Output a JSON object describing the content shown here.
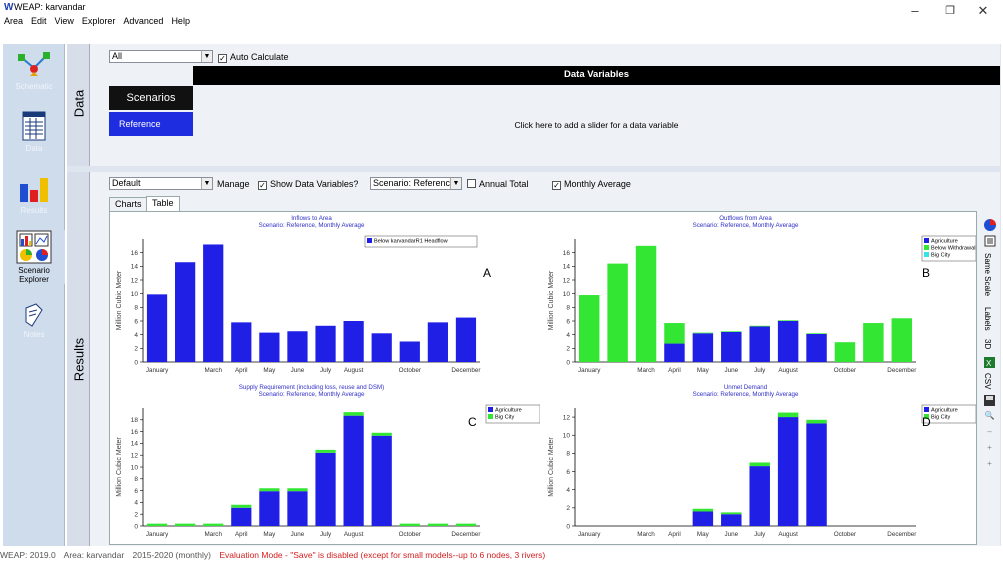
{
  "window": {
    "title": "WEAP: karvandar",
    "logo": "W"
  },
  "menu": [
    "Area",
    "Edit",
    "View",
    "Explorer",
    "Advanced",
    "Help"
  ],
  "sidebar": {
    "items": [
      {
        "name": "Schematic",
        "icon": "schematic-icon"
      },
      {
        "name": "Data",
        "icon": "data-icon"
      },
      {
        "name": "Results",
        "icon": "results-icon"
      },
      {
        "name": "Scenario Explorer",
        "icon": "scenario-explorer-icon"
      },
      {
        "name": "Notes",
        "icon": "notes-icon"
      }
    ]
  },
  "data_panel": {
    "label": "Data",
    "filter_value": "All",
    "auto_calc_label": "Auto Calculate",
    "auto_calc_checked": true,
    "dv_title": "Data Variables",
    "scenarios_label": "Scenarios",
    "scenario_ref": "Reference",
    "slider_hint": "Click here to add a slider for a data variable"
  },
  "results_panel": {
    "label": "Results",
    "favorite_value": "Default",
    "manage_label": "Manage",
    "show_dv_label": "Show Data Variables?",
    "show_dv_checked": true,
    "scenario_select": "Scenario: Reference",
    "annual_total_label": "Annual Total",
    "annual_total_checked": false,
    "monthly_avg_label": "Monthly Average",
    "monthly_avg_checked": true,
    "tabs": [
      "Charts",
      "Table"
    ]
  },
  "right_toolbar": {
    "same_scale": "Same Scale",
    "labels": "Labels",
    "three_d": "3D",
    "csv": "CSV"
  },
  "status": {
    "version": "WEAP: 2019.0",
    "area": "Area: karvandar",
    "period": "2015-2020 (monthly)",
    "warning": "Evaluation Mode - \"Save\" is disabled (except for small models--up to 6 nodes, 3 rivers)",
    "warning_color": "#d22020"
  },
  "colors": {
    "blue": "#1f1fe6",
    "green": "#33e633",
    "cyan": "#33e6e6"
  },
  "chart_data": [
    {
      "type": "bar",
      "letter": "A",
      "title": "Inflows to Area",
      "subtitle": "Scenario: Reference, Monthly Average",
      "ylabel": "Million Cubic Meter",
      "ylim": [
        0,
        18
      ],
      "yticks": [
        0,
        2,
        4,
        6,
        8,
        10,
        12,
        14,
        16
      ],
      "categories": [
        "January",
        "February",
        "March",
        "April",
        "May",
        "June",
        "July",
        "August",
        "September",
        "October",
        "November",
        "December"
      ],
      "xticklabels": [
        "January",
        "",
        "March",
        "April",
        "May",
        "June",
        "July",
        "August",
        "",
        "October",
        "",
        "December"
      ],
      "series": [
        {
          "name": "Below karvandarR1 Headflow",
          "color": "#1f1fe6",
          "values": [
            9.9,
            14.6,
            17.2,
            5.8,
            4.3,
            4.5,
            5.3,
            6.0,
            4.2,
            3.0,
            5.8,
            6.5
          ]
        }
      ]
    },
    {
      "type": "bar",
      "letter": "B",
      "title": "Outflows from Area",
      "subtitle": "Scenario: Reference, Monthly Average",
      "ylabel": "Million Cubic Meter",
      "ylim": [
        0,
        18
      ],
      "yticks": [
        0,
        2,
        4,
        6,
        8,
        10,
        12,
        14,
        16
      ],
      "categories": [
        "January",
        "February",
        "March",
        "April",
        "May",
        "June",
        "July",
        "August",
        "September",
        "October",
        "November",
        "December"
      ],
      "xticklabels": [
        "January",
        "",
        "March",
        "April",
        "May",
        "June",
        "July",
        "August",
        "",
        "October",
        "",
        "December"
      ],
      "series": [
        {
          "name": "Agriculture",
          "color": "#1f1fe6",
          "values": [
            0,
            0,
            0,
            2.7,
            4.2,
            4.4,
            5.2,
            6.0,
            4.1,
            0,
            0,
            0
          ]
        },
        {
          "name": "Below Withdrawal Node 2",
          "color": "#33e633",
          "values": [
            9.8,
            14.4,
            17.0,
            3.0,
            0.1,
            0.1,
            0.1,
            0.1,
            0.1,
            2.9,
            5.7,
            6.4
          ]
        },
        {
          "name": "Big City",
          "color": "#33e6e6",
          "values": [
            0,
            0,
            0,
            0,
            0,
            0,
            0,
            0,
            0,
            0,
            0,
            0
          ]
        }
      ]
    },
    {
      "type": "bar",
      "letter": "C",
      "title": "Supply Requirement (including loss, reuse and DSM)",
      "subtitle": "Scenario: Reference, Monthly Average",
      "ylabel": "Million Cubic Meter",
      "ylim": [
        0,
        20
      ],
      "yticks": [
        0,
        2,
        4,
        6,
        8,
        10,
        12,
        14,
        16,
        18
      ],
      "categories": [
        "January",
        "February",
        "March",
        "April",
        "May",
        "June",
        "July",
        "August",
        "September",
        "October",
        "November",
        "December"
      ],
      "xticklabels": [
        "January",
        "",
        "March",
        "April",
        "May",
        "June",
        "July",
        "August",
        "",
        "October",
        "",
        "December"
      ],
      "series": [
        {
          "name": "Agriculture",
          "color": "#1f1fe6",
          "values": [
            0,
            0,
            0,
            3.1,
            5.9,
            5.9,
            12.4,
            18.7,
            15.3,
            0,
            0,
            0
          ]
        },
        {
          "name": "Big City",
          "color": "#33e633",
          "values": [
            0.4,
            0.4,
            0.4,
            0.5,
            0.5,
            0.5,
            0.5,
            0.6,
            0.5,
            0.4,
            0.4,
            0.4
          ]
        }
      ]
    },
    {
      "type": "bar",
      "letter": "D",
      "title": "Unmet Demand",
      "subtitle": "Scenario: Reference, Monthly Average",
      "ylabel": "Million Cubic Meter",
      "ylim": [
        0,
        13
      ],
      "yticks": [
        0,
        2,
        4,
        6,
        8,
        10,
        12
      ],
      "categories": [
        "January",
        "February",
        "March",
        "April",
        "May",
        "June",
        "July",
        "August",
        "September",
        "October",
        "November",
        "December"
      ],
      "xticklabels": [
        "January",
        "",
        "March",
        "April",
        "May",
        "June",
        "July",
        "August",
        "",
        "October",
        "",
        "December"
      ],
      "series": [
        {
          "name": "Agriculture",
          "color": "#1f1fe6",
          "values": [
            0,
            0,
            0,
            0,
            1.6,
            1.3,
            6.6,
            12.0,
            11.3,
            0,
            0,
            0
          ]
        },
        {
          "name": "Big City",
          "color": "#33e633",
          "values": [
            0,
            0,
            0,
            0,
            0.3,
            0.2,
            0.4,
            0.5,
            0.4,
            0,
            0,
            0
          ]
        }
      ]
    }
  ]
}
